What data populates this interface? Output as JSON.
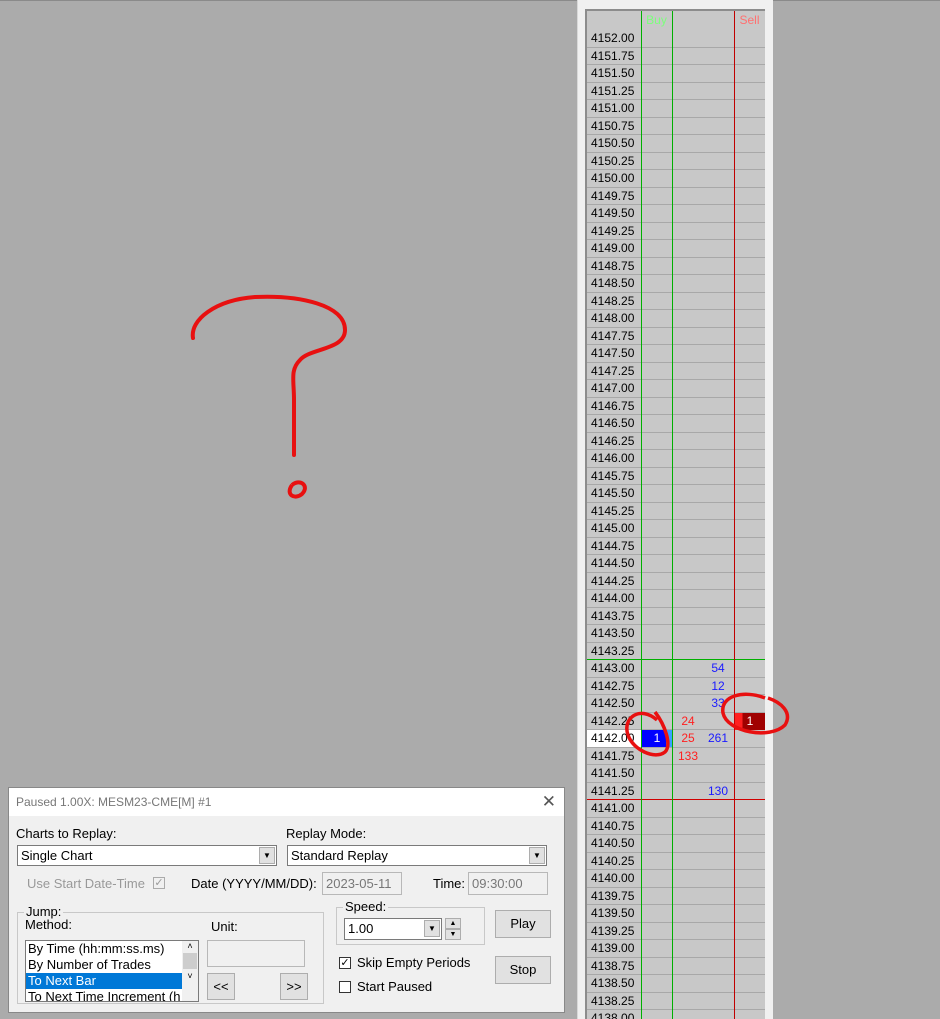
{
  "ladder": {
    "buy_header": "Buy",
    "sell_header": "Sell",
    "current_price": "4142.00",
    "prices": [
      "4152.00",
      "4151.75",
      "4151.50",
      "4151.25",
      "4151.00",
      "4150.75",
      "4150.50",
      "4150.25",
      "4150.00",
      "4149.75",
      "4149.50",
      "4149.25",
      "4149.00",
      "4148.75",
      "4148.50",
      "4148.25",
      "4148.00",
      "4147.75",
      "4147.50",
      "4147.25",
      "4147.00",
      "4146.75",
      "4146.50",
      "4146.25",
      "4146.00",
      "4145.75",
      "4145.50",
      "4145.25",
      "4145.00",
      "4144.75",
      "4144.50",
      "4144.25",
      "4144.00",
      "4143.75",
      "4143.50",
      "4143.25",
      "4143.00",
      "4142.75",
      "4142.50",
      "4142.25",
      "4142.00",
      "4141.75",
      "4141.50",
      "4141.25",
      "4141.00",
      "4140.75",
      "4140.50",
      "4140.25",
      "4140.00",
      "4139.75",
      "4139.50",
      "4139.25",
      "4139.00",
      "4138.75",
      "4138.50",
      "4138.25",
      "4138.00"
    ],
    "red_volumes": {
      "4142.25": "24",
      "4142.00": "25",
      "4141.75": "133"
    },
    "blue_volumes": {
      "4143.00": "54",
      "4142.75": "12",
      "4142.50": "33",
      "4142.00": "261",
      "4141.25": "130"
    },
    "buy_orders": {
      "4142.00": "1"
    },
    "sell_orders": {
      "4142.25": "1"
    },
    "high_line_price": "4143.00",
    "low_line_price": "4141.00",
    "colors": {
      "buy": "#00c000",
      "sell": "#d00000",
      "blue_vol": "#1a1aff",
      "red_vol": "#ff2020"
    }
  },
  "dialog": {
    "title": "Paused 1.00X: MESM23-CME[M]  #1",
    "charts_label": "Charts to Replay:",
    "charts_value": "Single Chart",
    "mode_label": "Replay Mode:",
    "mode_value": "Standard Replay",
    "use_start": "Use Start Date-Time",
    "date_label": "Date (YYYY/MM/DD):",
    "date_value": "2023-05-11",
    "time_label": "Time:",
    "time_value": "09:30:00",
    "jump_label": "Jump:",
    "method_label": "Method:",
    "unit_label": "Unit:",
    "methods": [
      "By Time (hh:mm:ss.ms)",
      "By Number of Trades",
      "To Next Bar",
      "To Next Time Increment (h"
    ],
    "back_btn": "<<",
    "fwd_btn": ">>",
    "speed_label": "Speed:",
    "speed_value": "1.00",
    "skip_empty": "Skip Empty Periods",
    "start_paused": "Start Paused",
    "play": "Play",
    "stop": "Stop"
  }
}
